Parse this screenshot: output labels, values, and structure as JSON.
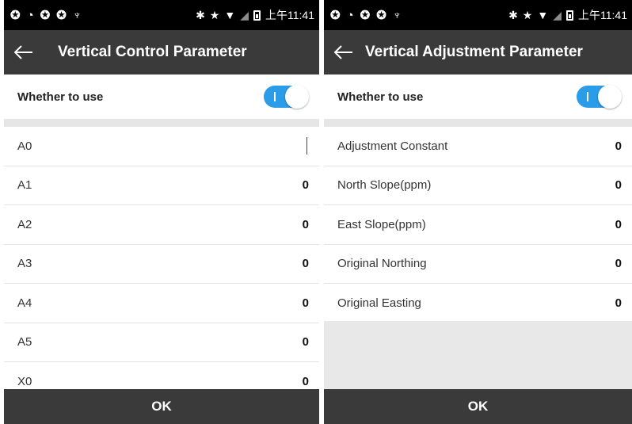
{
  "status_bar": {
    "time": "上午11:41"
  },
  "left_screen": {
    "title": "Vertical Control Parameter",
    "whether_to_use_label": "Whether to use",
    "rows": [
      {
        "label": "A0",
        "value": ""
      },
      {
        "label": "A1",
        "value": "0"
      },
      {
        "label": "A2",
        "value": "0"
      },
      {
        "label": "A3",
        "value": "0"
      },
      {
        "label": "A4",
        "value": "0"
      },
      {
        "label": "A5",
        "value": "0"
      },
      {
        "label": "X0",
        "value": "0"
      }
    ],
    "ok_label": "OK"
  },
  "right_screen": {
    "title": "Vertical Adjustment Parameter",
    "whether_to_use_label": "Whether to use",
    "rows": [
      {
        "label": "Adjustment Constant",
        "value": "0"
      },
      {
        "label": "North Slope(ppm)",
        "value": "0"
      },
      {
        "label": "East Slope(ppm)",
        "value": "0"
      },
      {
        "label": "Original Northing",
        "value": "0"
      },
      {
        "label": "Original Easting",
        "value": "0"
      }
    ],
    "ok_label": "OK"
  },
  "colors": {
    "toolbar": "#3a3a3a",
    "toggle_on": "#2a9ce8",
    "status_bar": "#000000"
  },
  "icons": [
    "sync-icon",
    "alarm-icon",
    "bluetooth-icon",
    "star-icon",
    "wifi-icon",
    "signal-icon",
    "battery-icon",
    "back-arrow-icon"
  ]
}
